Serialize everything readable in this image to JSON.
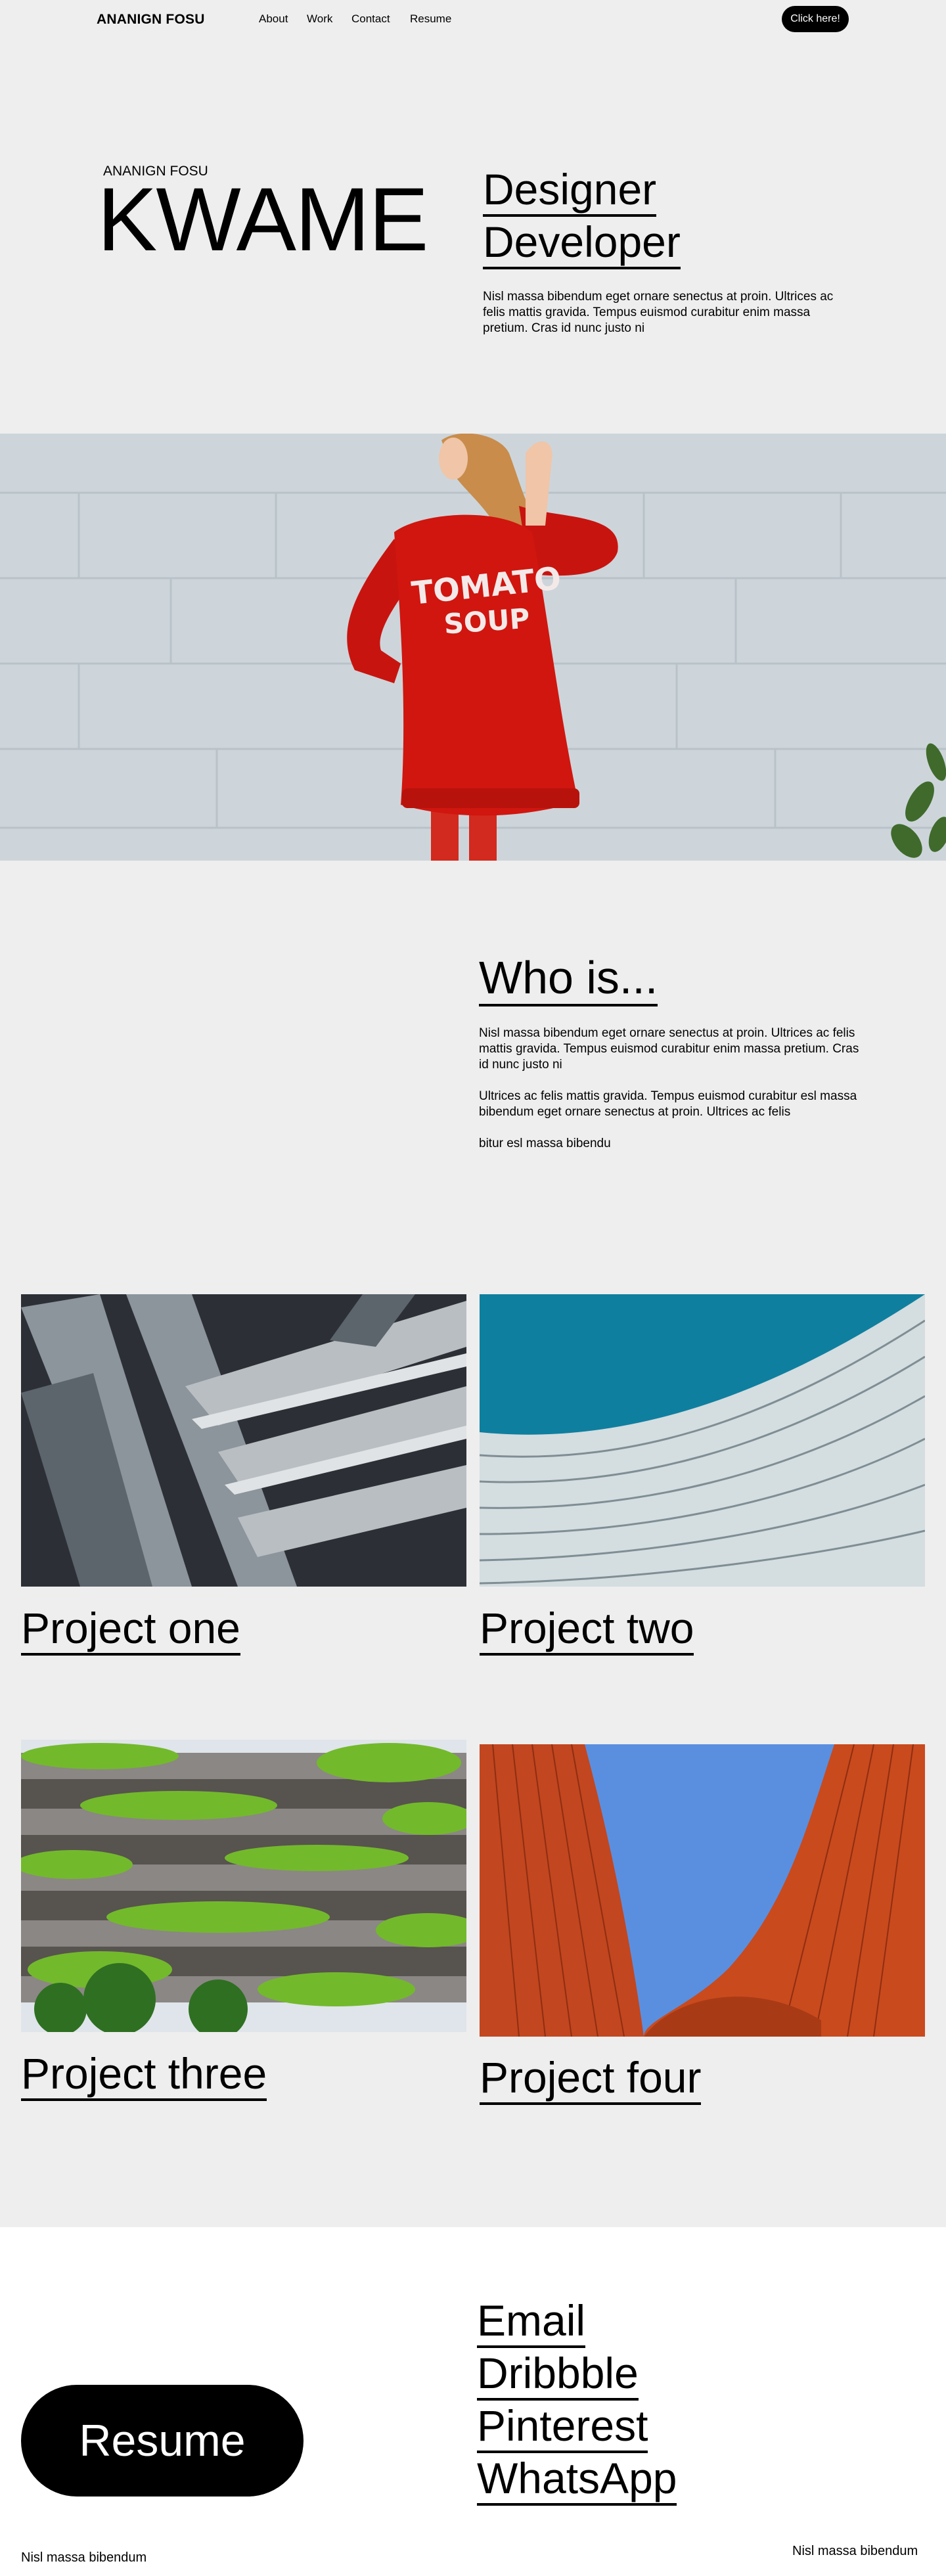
{
  "nav": {
    "brand": "ANANIGN FOSU",
    "links": [
      "About",
      "Work",
      "Contact",
      "Resume"
    ],
    "cta": "Click here!"
  },
  "hero": {
    "subtitle": "ANANIGN FOSU",
    "title": "KWAME",
    "roles": [
      "Designer",
      "Developer"
    ],
    "description": "Nisl massa bibendum eget ornare senectus at proin. Ultrices ac felis mattis gravida. Tempus euismod curabitur enim massa pretium. Cras id nunc justo ni"
  },
  "photo": {
    "shirt_text_line1": "TOMATO",
    "shirt_text_line2": "SOUP"
  },
  "about": {
    "title": "Who is...",
    "paragraphs": [
      "Nisl massa bibendum eget ornare senectus at proin. Ultrices ac felis mattis gravida. Tempus euismod curabitur enim massa pretium. Cras id nunc justo ni",
      "Ultrices ac felis mattis gravida. Tempus euismod curabitur esl massa bibendum eget ornare senectus at proin. Ultrices ac felis",
      "bitur esl massa bibendu"
    ]
  },
  "projects": [
    {
      "title": "Project one"
    },
    {
      "title": "Project two"
    },
    {
      "title": "Project three"
    },
    {
      "title": "Project four"
    }
  ],
  "footer": {
    "contacts": [
      "Email",
      "Dribbble",
      "Pinterest",
      "WhatsApp"
    ],
    "resume_button": "Resume",
    "left_text": "Nisl massa bibendum",
    "right_text": "Nisl massa bibendum"
  }
}
